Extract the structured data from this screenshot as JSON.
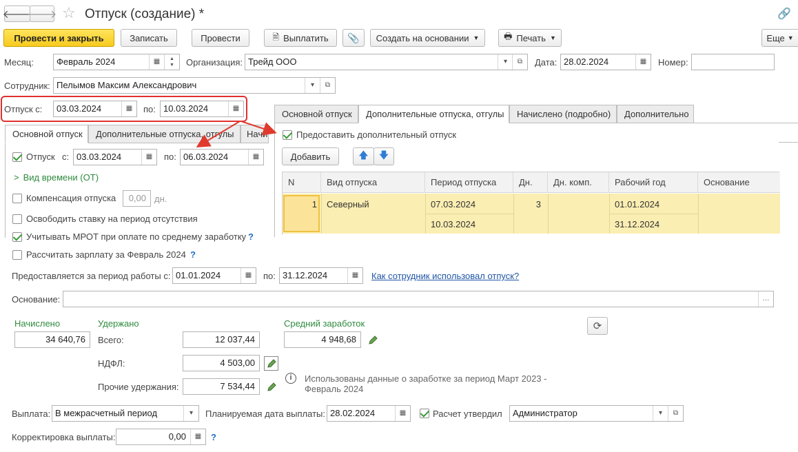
{
  "window": {
    "title": "Отпуск (создание) *"
  },
  "toolbar": {
    "post_close": "Провести и закрыть",
    "save": "Записать",
    "post": "Провести",
    "pay": "Выплатить",
    "create_based": "Создать на основании",
    "print": "Печать",
    "more": "Еще"
  },
  "header": {
    "month_label": "Месяц:",
    "month_value": "Февраль 2024",
    "org_label": "Организация:",
    "org_value": "Трейд ООО",
    "date_label": "Дата:",
    "date_value": "28.02.2024",
    "number_label": "Номер:",
    "number_value": "",
    "employee_label": "Сотрудник:",
    "employee_value": "Пелымов Максим Александрович"
  },
  "vacation": {
    "from_label": "Отпуск с:",
    "from_value": "03.03.2024",
    "to_label": "по:",
    "to_value": "10.03.2024"
  },
  "left_tabs": [
    "Основной отпуск",
    "Дополнительные отпуска, отгулы",
    "Начи"
  ],
  "main_tab": {
    "vacation_label": "Отпуск",
    "from_label": "с:",
    "from_value": "03.03.2024",
    "to_label": "по:",
    "to_value": "06.03.2024",
    "time_type": "Вид времени (ОТ)",
    "compensation_label": "Компенсация отпуска",
    "compensation_value": "0,00",
    "compensation_unit": "дн.",
    "free_rate": "Освободить ставку на период отсутствия",
    "mrot": "Учитывать МРОТ при оплате по среднему заработку",
    "calc_salary": "Рассчитать зарплату за Февраль 2024"
  },
  "right_tabs": [
    "Основной отпуск",
    "Дополнительные отпуска, отгулы",
    "Начислено (подробно)",
    "Дополнительно"
  ],
  "additional": {
    "provide_label": "Предоставить дополнительный отпуск",
    "add_button": "Добавить",
    "columns": [
      "N",
      "Вид отпуска",
      "Период отпуска",
      "Дн.",
      "Дн. комп.",
      "Рабочий год",
      "Основание"
    ],
    "rows": [
      {
        "n": "1",
        "type": "Северный",
        "period_from": "07.03.2024",
        "period_to": "10.03.2024",
        "days": "3",
        "comp_days": "",
        "year_from": "01.01.2024",
        "year_to": "31.12.2024",
        "reason": ""
      }
    ]
  },
  "work_period": {
    "label": "Предоставляется за период работы с:",
    "from_value": "01.01.2024",
    "to_label": "по:",
    "to_value": "31.12.2024",
    "link": "Как сотрудник использовал отпуск?"
  },
  "basis": {
    "label": "Основание:",
    "value": ""
  },
  "totals": {
    "accrued_label": "Начислено",
    "accrued_value": "34 640,76",
    "withheld_label": "Удержано",
    "total_label": "Всего:",
    "total_value": "12 037,44",
    "ndfl_label": "НДФЛ:",
    "ndfl_value": "4 503,00",
    "other_label": "Прочие удержания:",
    "other_value": "7 534,44",
    "avg_label": "Средний заработок",
    "avg_value": "4 948,68",
    "info_text_1": "Использованы данные о заработке за период Март 2023 -",
    "info_text_2": "Февраль 2024"
  },
  "payment": {
    "label": "Выплата:",
    "value": "В межрасчетный период",
    "planned_label": "Планируемая дата выплаты:",
    "planned_value": "28.02.2024",
    "approved_label": "Расчет утвердил",
    "approved_value": "Администратор",
    "correction_label": "Корректировка выплаты:",
    "correction_value": "0,00"
  },
  "colors": {
    "primary_button": "#f7ca1e",
    "highlight_frame": "#e03030",
    "arrow": "#e03a2e",
    "selected_row": "#fbeeb2",
    "green_caption": "#2f8a3e",
    "link": "#1f55a6"
  }
}
